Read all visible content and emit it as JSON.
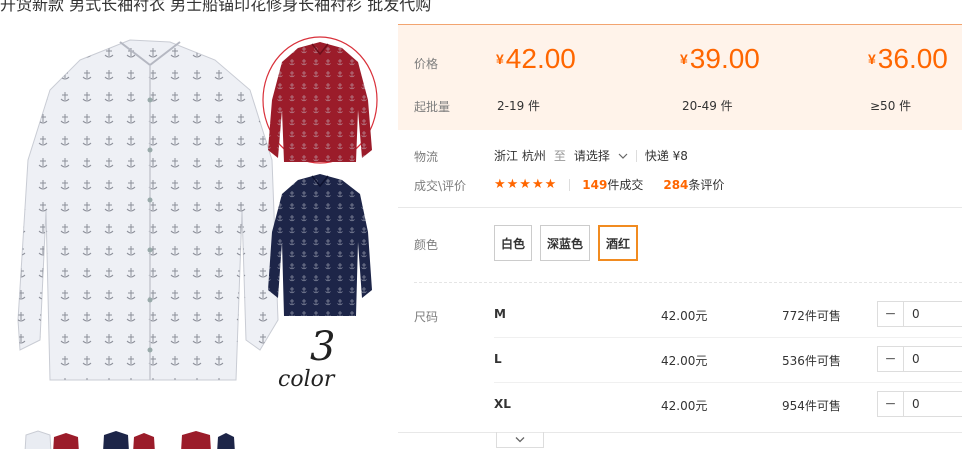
{
  "title": "开货新款 男式长袖衬衣 男士船锚印花修身长袖衬衫 批发代购",
  "gallery": {
    "badge_number": "3",
    "badge_text": "color",
    "colors": {
      "white": "#e9ecf2",
      "red": "#9b1c2a",
      "navy": "#1d2548"
    }
  },
  "price_box": {
    "price_label": "价格",
    "qty_label": "起批量",
    "currency": "¥",
    "tiers": [
      {
        "price": "42.00",
        "qty": "2-19 件"
      },
      {
        "price": "39.00",
        "qty": "20-49 件"
      },
      {
        "price": "36.00",
        "qty": "≥50 件"
      }
    ]
  },
  "logistics": {
    "label": "物流",
    "from": "浙江 杭州",
    "to_word": "至",
    "dest": "请选择",
    "method": "快递 ¥8"
  },
  "deal": {
    "label": "成交\\评价",
    "stars": "★★★★★",
    "sold_count": "149",
    "sold_text": "件成交",
    "review_count": "284",
    "review_text": "条评价"
  },
  "color": {
    "label": "颜色",
    "options": [
      "白色",
      "深蓝色",
      "酒红"
    ],
    "selected": "酒红"
  },
  "size": {
    "label": "尺码",
    "rows": [
      {
        "size": "M",
        "price": "42.00元",
        "stock": "772件可售",
        "qty": "0"
      },
      {
        "size": "L",
        "price": "42.00元",
        "stock": "536件可售",
        "qty": "0"
      },
      {
        "size": "XL",
        "price": "42.00元",
        "stock": "954件可售",
        "qty": "0"
      }
    ]
  },
  "accent_color": "#ff6600"
}
